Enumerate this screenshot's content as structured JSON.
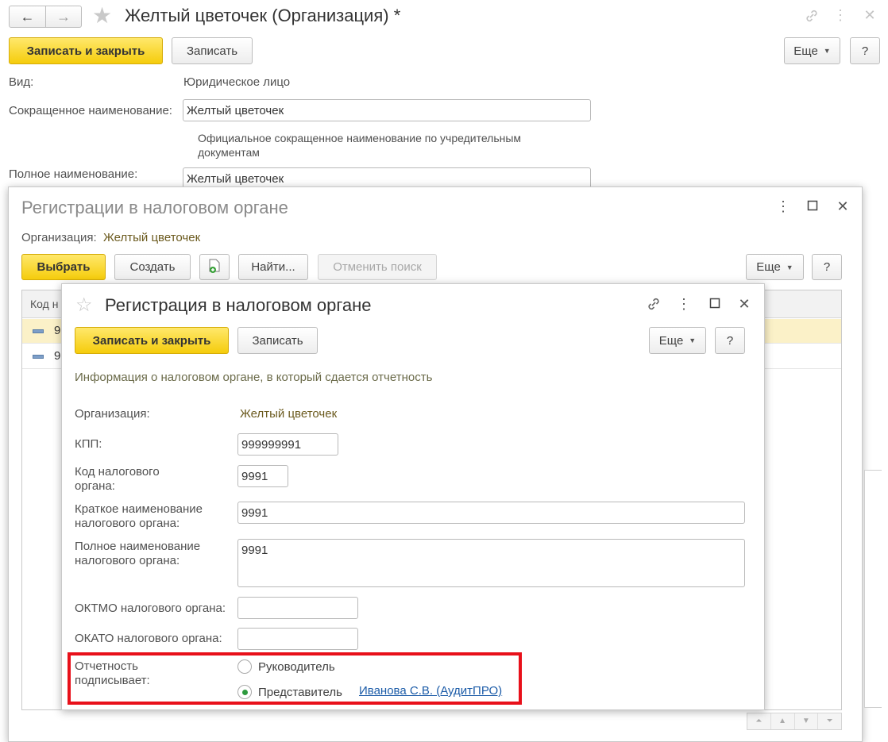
{
  "main": {
    "title": "Желтый цветочек (Организация) *",
    "nav_back": "←",
    "nav_forward": "→",
    "buttons": {
      "save_close": "Записать и закрыть",
      "save": "Записать",
      "more": "Еще",
      "help": "?"
    },
    "fields": {
      "vid_label": "Вид:",
      "vid_value": "Юридическое лицо",
      "short_name_label": "Сокращенное наименование:",
      "short_name_value": "Желтый цветочек",
      "short_name_hint": "Официальное сокращенное наименование по учредительным документам",
      "full_name_label": "Полное наименование:",
      "full_name_value": "Желтый цветочек"
    }
  },
  "list_window": {
    "title": "Регистрации в налоговом органе",
    "org_label": "Организация:",
    "org_value": "Желтый цветочек",
    "buttons": {
      "select": "Выбрать",
      "create": "Создать",
      "find": "Найти...",
      "cancel_search": "Отменить поиск",
      "more": "Еще",
      "help": "?"
    },
    "table": {
      "column_code": "Код н",
      "rows": [
        {
          "code": "9"
        },
        {
          "code": "9"
        }
      ]
    }
  },
  "dialog": {
    "title": "Регистрация в налоговом органе",
    "buttons": {
      "save_close": "Записать и закрыть",
      "save": "Записать",
      "more": "Еще",
      "help": "?"
    },
    "info_text": "Информация о налоговом органе, в который сдается отчетность",
    "org_label": "Организация:",
    "org_value": "Желтый цветочек",
    "kpp_label": "КПП:",
    "kpp_value": "999999991",
    "tax_code_label_1": "Код налогового",
    "tax_code_label_2": "органа:",
    "tax_code_value": "9991",
    "short_name_label_1": "Краткое наименование",
    "short_name_label_2": "налогового органа:",
    "short_name_value": "9991",
    "full_name_label_1": "Полное наименование",
    "full_name_label_2": "налогового органа:",
    "full_name_value": "9991",
    "oktmo_label": "ОКТМО налогового органа:",
    "oktmo_value": "",
    "okato_label": "ОКАТО налогового органа:",
    "okato_value": "",
    "signer_label_1": "Отчетность",
    "signer_label_2": "подписывает:",
    "signer_option_head": "Руководитель",
    "signer_option_rep": "Представитель",
    "signer_selected": "Представитель",
    "representative_link": "Иванова С.В. (АудитПРО)"
  },
  "colors": {
    "accent_yellow": "#f5cc0c",
    "highlight_red": "#e8101a",
    "link_blue": "#1c5ca8",
    "org_value_brown": "#6b5a1e",
    "row_highlight": "#fbf1c8"
  }
}
